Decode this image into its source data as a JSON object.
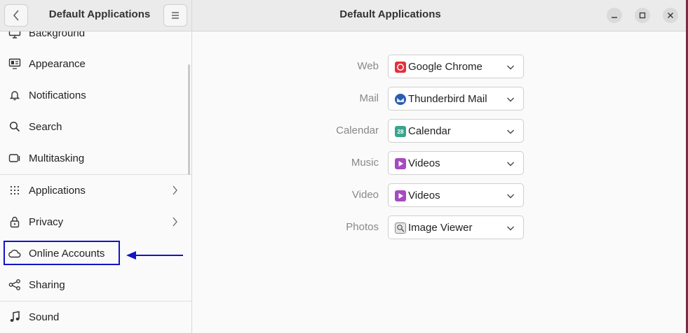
{
  "sidebar": {
    "title": "Default Applications",
    "items": [
      {
        "label": "Background",
        "icon": "monitor-icon"
      },
      {
        "label": "Appearance",
        "icon": "appearance-icon"
      },
      {
        "label": "Notifications",
        "icon": "bell-icon"
      },
      {
        "label": "Search",
        "icon": "search-icon"
      },
      {
        "label": "Multitasking",
        "icon": "multitasking-icon"
      },
      {
        "label": "Applications",
        "icon": "grid-icon"
      },
      {
        "label": "Privacy",
        "icon": "lock-icon"
      },
      {
        "label": "Online Accounts",
        "icon": "cloud-icon"
      },
      {
        "label": "Sharing",
        "icon": "share-icon"
      },
      {
        "label": "Sound",
        "icon": "music-note-icon"
      }
    ]
  },
  "main": {
    "title": "Default Applications",
    "rows": [
      {
        "label": "Web",
        "value": "Google Chrome",
        "icon": "chrome-icon",
        "icon_color": "#e2313b"
      },
      {
        "label": "Mail",
        "value": "Thunderbird Mail",
        "icon": "thunderbird-icon",
        "icon_color": "#2a5db0"
      },
      {
        "label": "Calendar",
        "value": "Calendar",
        "icon": "calendar-icon",
        "icon_color": "#3aa58e"
      },
      {
        "label": "Music",
        "value": "Videos",
        "icon": "videos-icon",
        "icon_color": "#a64bbf"
      },
      {
        "label": "Video",
        "value": "Videos",
        "icon": "videos-icon",
        "icon_color": "#a64bbf"
      },
      {
        "label": "Photos",
        "value": "Image Viewer",
        "icon": "image-viewer-icon",
        "icon_color": "#8a8a8a"
      }
    ]
  },
  "calendar_icon_text": "28",
  "colors": {
    "highlight": "#1313c8",
    "arrow": "#1313c8",
    "window_edge": "#7a2a48"
  }
}
